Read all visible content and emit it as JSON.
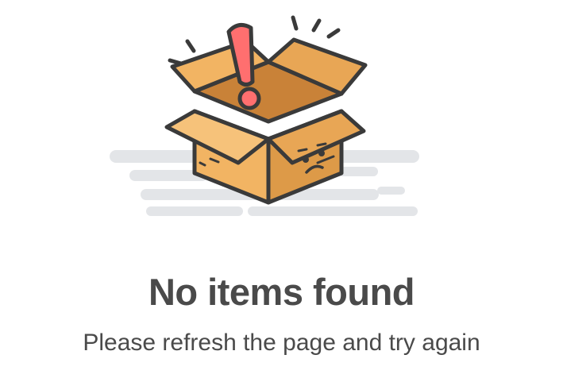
{
  "empty_state": {
    "title": "No items found",
    "message": "Please refresh the page and try again",
    "illustration_icon": "empty-box-icon",
    "colors": {
      "text": "#4a4a4a",
      "box": "#f2b463",
      "box_shade": "#dd9a48",
      "box_inside": "#c98238",
      "outline": "#3a3a3a",
      "exclamation": "#ff6f6f",
      "cloud": "#e3e5e8"
    }
  }
}
